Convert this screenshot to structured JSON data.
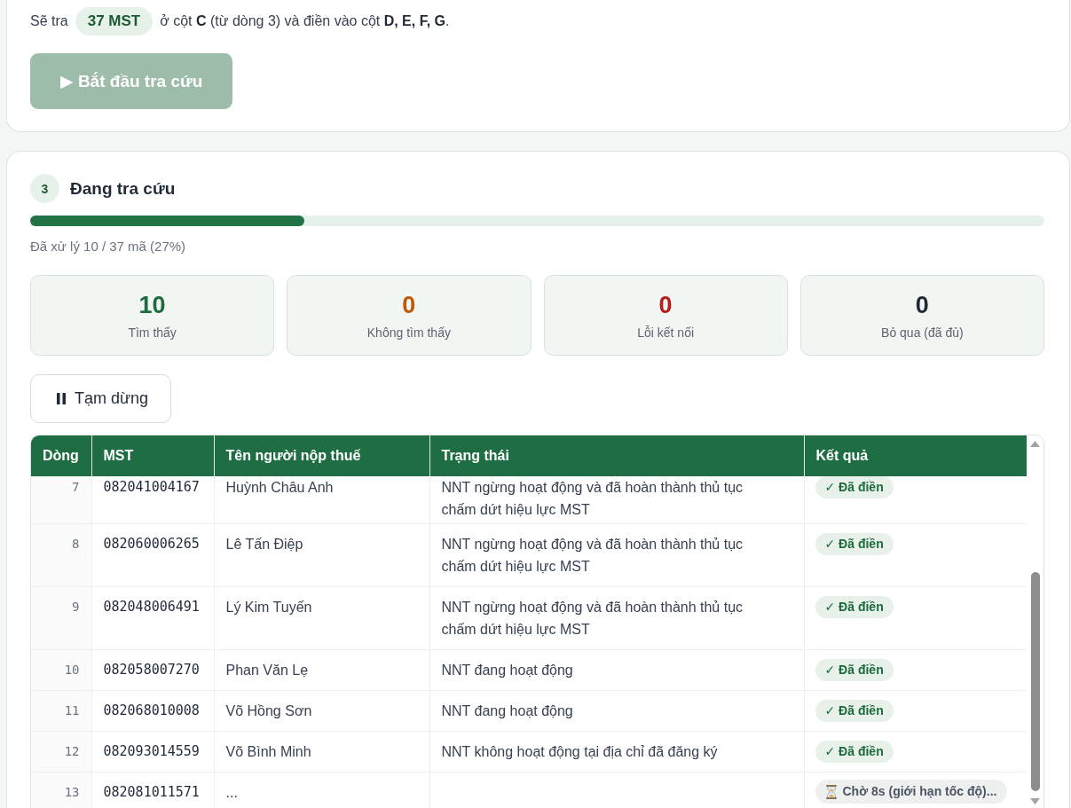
{
  "setup": {
    "summary_lead": "Sẽ tra",
    "count_badge": "37 MST",
    "summary_rest": "ở cột **C** (từ dòng 3) và điền vào cột **D, E, F, G**.",
    "start_button": {
      "label": "▶ Bắt đầu tra cứu",
      "disabled": true
    }
  },
  "lookup": {
    "step": "3",
    "title": "Đang tra cứu",
    "progress": {
      "level": 0.27,
      "caption": "Đã xử lý 10 / 37 mã (27%)"
    },
    "stats": [
      {
        "value": "10",
        "label": "Tìm thấy",
        "color": "#1e6b3e"
      },
      {
        "value": "0",
        "label": "Không tìm thấy",
        "color": "#c2570c"
      },
      {
        "value": "0",
        "label": "Lỗi kết nối",
        "color": "#b91c1c"
      },
      {
        "value": "0",
        "label": "Bỏ qua (đã đủ)",
        "color": "#1f2937"
      }
    ],
    "pause_button": {
      "label": "Tạm dừng"
    },
    "table": {
      "columns": [
        "Dòng",
        "MST",
        "Tên người nộp thuế",
        "Trạng thái",
        "Kết quả"
      ],
      "rows": [
        {
          "line": "7",
          "mst": "082041004167",
          "name": "Huỳnh Châu Anh",
          "status": "NNT ngừng hoạt động và đã hoàn thành thủ tục chấm dứt hiệu lực MST",
          "result": {
            "kind": "filled",
            "text": "✓ Đã điền"
          }
        },
        {
          "line": "8",
          "mst": "082060006265",
          "name": "Lê Tấn Điệp",
          "status": "NNT ngừng hoạt động và đã hoàn thành thủ tục chấm dứt hiệu lực MST",
          "result": {
            "kind": "filled",
            "text": "✓ Đã điền"
          }
        },
        {
          "line": "9",
          "mst": "082048006491",
          "name": "Lý Kim Tuyến",
          "status": "NNT ngừng hoạt động và đã hoàn thành thủ tục chấm dứt hiệu lực MST",
          "result": {
            "kind": "filled",
            "text": "✓ Đã điền"
          }
        },
        {
          "line": "10",
          "mst": "082058007270",
          "name": "Phan Văn Lẹ",
          "status": "NNT đang hoạt động",
          "result": {
            "kind": "filled",
            "text": "✓ Đã điền"
          }
        },
        {
          "line": "11",
          "mst": "082068010008",
          "name": "Võ Hồng Sơn",
          "status": "NNT đang hoạt động",
          "result": {
            "kind": "filled",
            "text": "✓ Đã điền"
          }
        },
        {
          "line": "12",
          "mst": "082093014559",
          "name": "Võ Bình Minh",
          "status": "NNT không hoạt động tại địa chỉ đã đăng ký",
          "result": {
            "kind": "filled",
            "text": "✓ Đã điền"
          }
        },
        {
          "line": "13",
          "mst": "082081011571",
          "name": "...",
          "result": {
            "kind": "waiting",
            "text": "Chờ 8s (giới hạn tốc độ)..."
          }
        }
      ]
    }
  }
}
